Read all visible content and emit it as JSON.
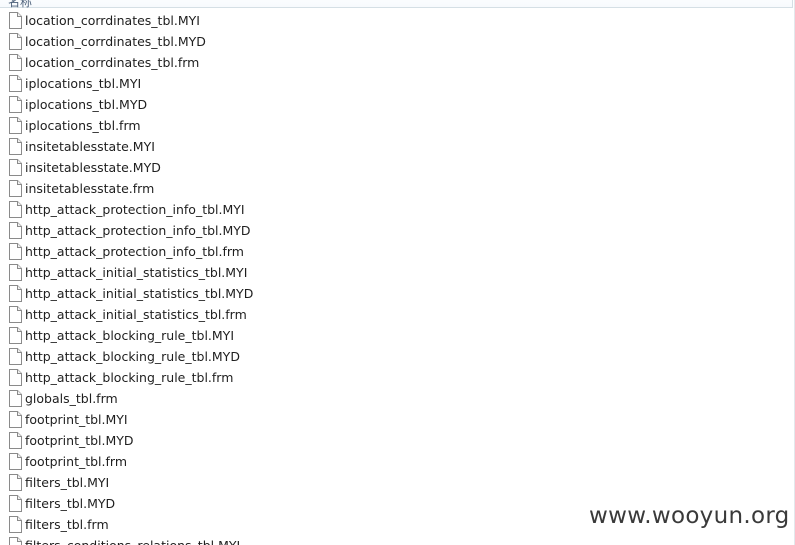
{
  "header": {
    "column_label": "名称"
  },
  "files": [
    {
      "name": "location_corrdinates_tbl.MYI",
      "icon": "file-icon"
    },
    {
      "name": "location_corrdinates_tbl.MYD",
      "icon": "file-icon"
    },
    {
      "name": "location_corrdinates_tbl.frm",
      "icon": "file-icon"
    },
    {
      "name": "iplocations_tbl.MYI",
      "icon": "file-icon"
    },
    {
      "name": "iplocations_tbl.MYD",
      "icon": "file-icon"
    },
    {
      "name": "iplocations_tbl.frm",
      "icon": "file-icon"
    },
    {
      "name": "insitetablesstate.MYI",
      "icon": "file-icon"
    },
    {
      "name": "insitetablesstate.MYD",
      "icon": "file-icon"
    },
    {
      "name": "insitetablesstate.frm",
      "icon": "file-icon"
    },
    {
      "name": "http_attack_protection_info_tbl.MYI",
      "icon": "file-icon"
    },
    {
      "name": "http_attack_protection_info_tbl.MYD",
      "icon": "file-icon"
    },
    {
      "name": "http_attack_protection_info_tbl.frm",
      "icon": "file-icon"
    },
    {
      "name": "http_attack_initial_statistics_tbl.MYI",
      "icon": "file-icon"
    },
    {
      "name": "http_attack_initial_statistics_tbl.MYD",
      "icon": "file-icon"
    },
    {
      "name": "http_attack_initial_statistics_tbl.frm",
      "icon": "file-icon"
    },
    {
      "name": "http_attack_blocking_rule_tbl.MYI",
      "icon": "file-icon"
    },
    {
      "name": "http_attack_blocking_rule_tbl.MYD",
      "icon": "file-icon"
    },
    {
      "name": "http_attack_blocking_rule_tbl.frm",
      "icon": "file-icon"
    },
    {
      "name": "globals_tbl.frm",
      "icon": "file-icon"
    },
    {
      "name": "footprint_tbl.MYI",
      "icon": "file-icon"
    },
    {
      "name": "footprint_tbl.MYD",
      "icon": "file-icon"
    },
    {
      "name": "footprint_tbl.frm",
      "icon": "file-icon"
    },
    {
      "name": "filters_tbl.MYI",
      "icon": "file-icon"
    },
    {
      "name": "filters_tbl.MYD",
      "icon": "file-icon"
    },
    {
      "name": "filters_tbl.frm",
      "icon": "file-icon"
    },
    {
      "name": "filters_conditions_relations_tbl.MYI",
      "icon": "file-icon"
    }
  ],
  "watermark": "www.wooyun.org"
}
